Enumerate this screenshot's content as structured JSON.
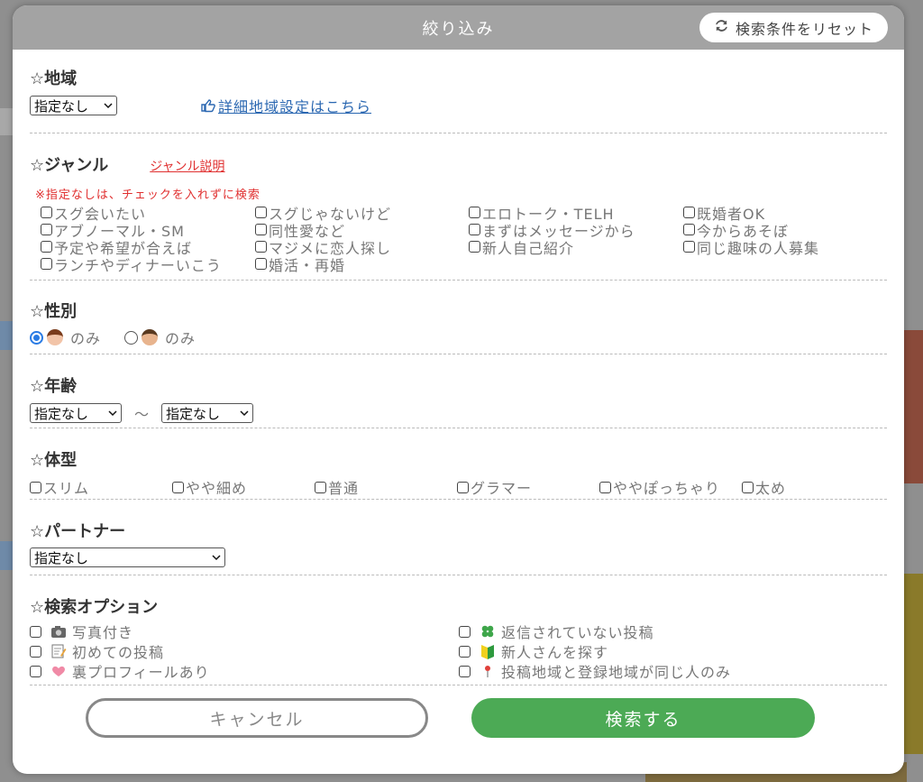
{
  "modal": {
    "title": "絞り込み",
    "reset_label": "検索条件をリセット"
  },
  "region": {
    "title": "☆地域",
    "select_value": "指定なし",
    "detail_link": "詳細地域設定はこちら"
  },
  "genre": {
    "title": "☆ジャンル",
    "help_link": "ジャンル説明",
    "note": "※指定なしは、チェックを入れずに検索",
    "items": [
      "スグ会いたい",
      "スグじゃないけど",
      "エロトーク・TELH",
      "既婚者OK",
      "アブノーマル・SM",
      "同性愛など",
      "まずはメッセージから",
      "今からあそぼ",
      "予定や希望が合えば",
      "マジメに恋人探し",
      "新人自己紹介",
      "同じ趣味の人募集",
      "ランチやディナーいこう",
      "婚活・再婚"
    ]
  },
  "gender": {
    "title": "☆性別",
    "female_label": "のみ",
    "male_label": "のみ",
    "selected": "female"
  },
  "age": {
    "title": "☆年齢",
    "from_value": "指定なし",
    "separator": "〜",
    "to_value": "指定なし"
  },
  "body_type": {
    "title": "☆体型",
    "items": [
      "スリム",
      "やや細め",
      "普通",
      "グラマー",
      "ややぽっちゃり",
      "太め"
    ]
  },
  "partner": {
    "title": "☆パートナー",
    "select_value": "指定なし"
  },
  "options": {
    "title": "☆検索オプション",
    "left": [
      {
        "label": "写真付き",
        "icon": "camera-icon"
      },
      {
        "label": "初めての投稿",
        "icon": "memo-icon"
      },
      {
        "label": "裏プロフィールあり",
        "icon": "heart-icon"
      }
    ],
    "right": [
      {
        "label": "返信されていない投稿",
        "icon": "clover-icon"
      },
      {
        "label": "新人さんを探す",
        "icon": "beginner-mark-icon"
      },
      {
        "label": "投稿地域と登録地域が同じ人のみ",
        "icon": "pin-icon"
      }
    ]
  },
  "footer": {
    "cancel_label": "キャンセル",
    "search_label": "検索する"
  },
  "colors": {
    "header_bg": "#a3a3a3",
    "search_green": "#4caa55",
    "link_blue": "#2a67b1",
    "note_red": "#e03030",
    "radio_blue": "#2a7be4"
  }
}
